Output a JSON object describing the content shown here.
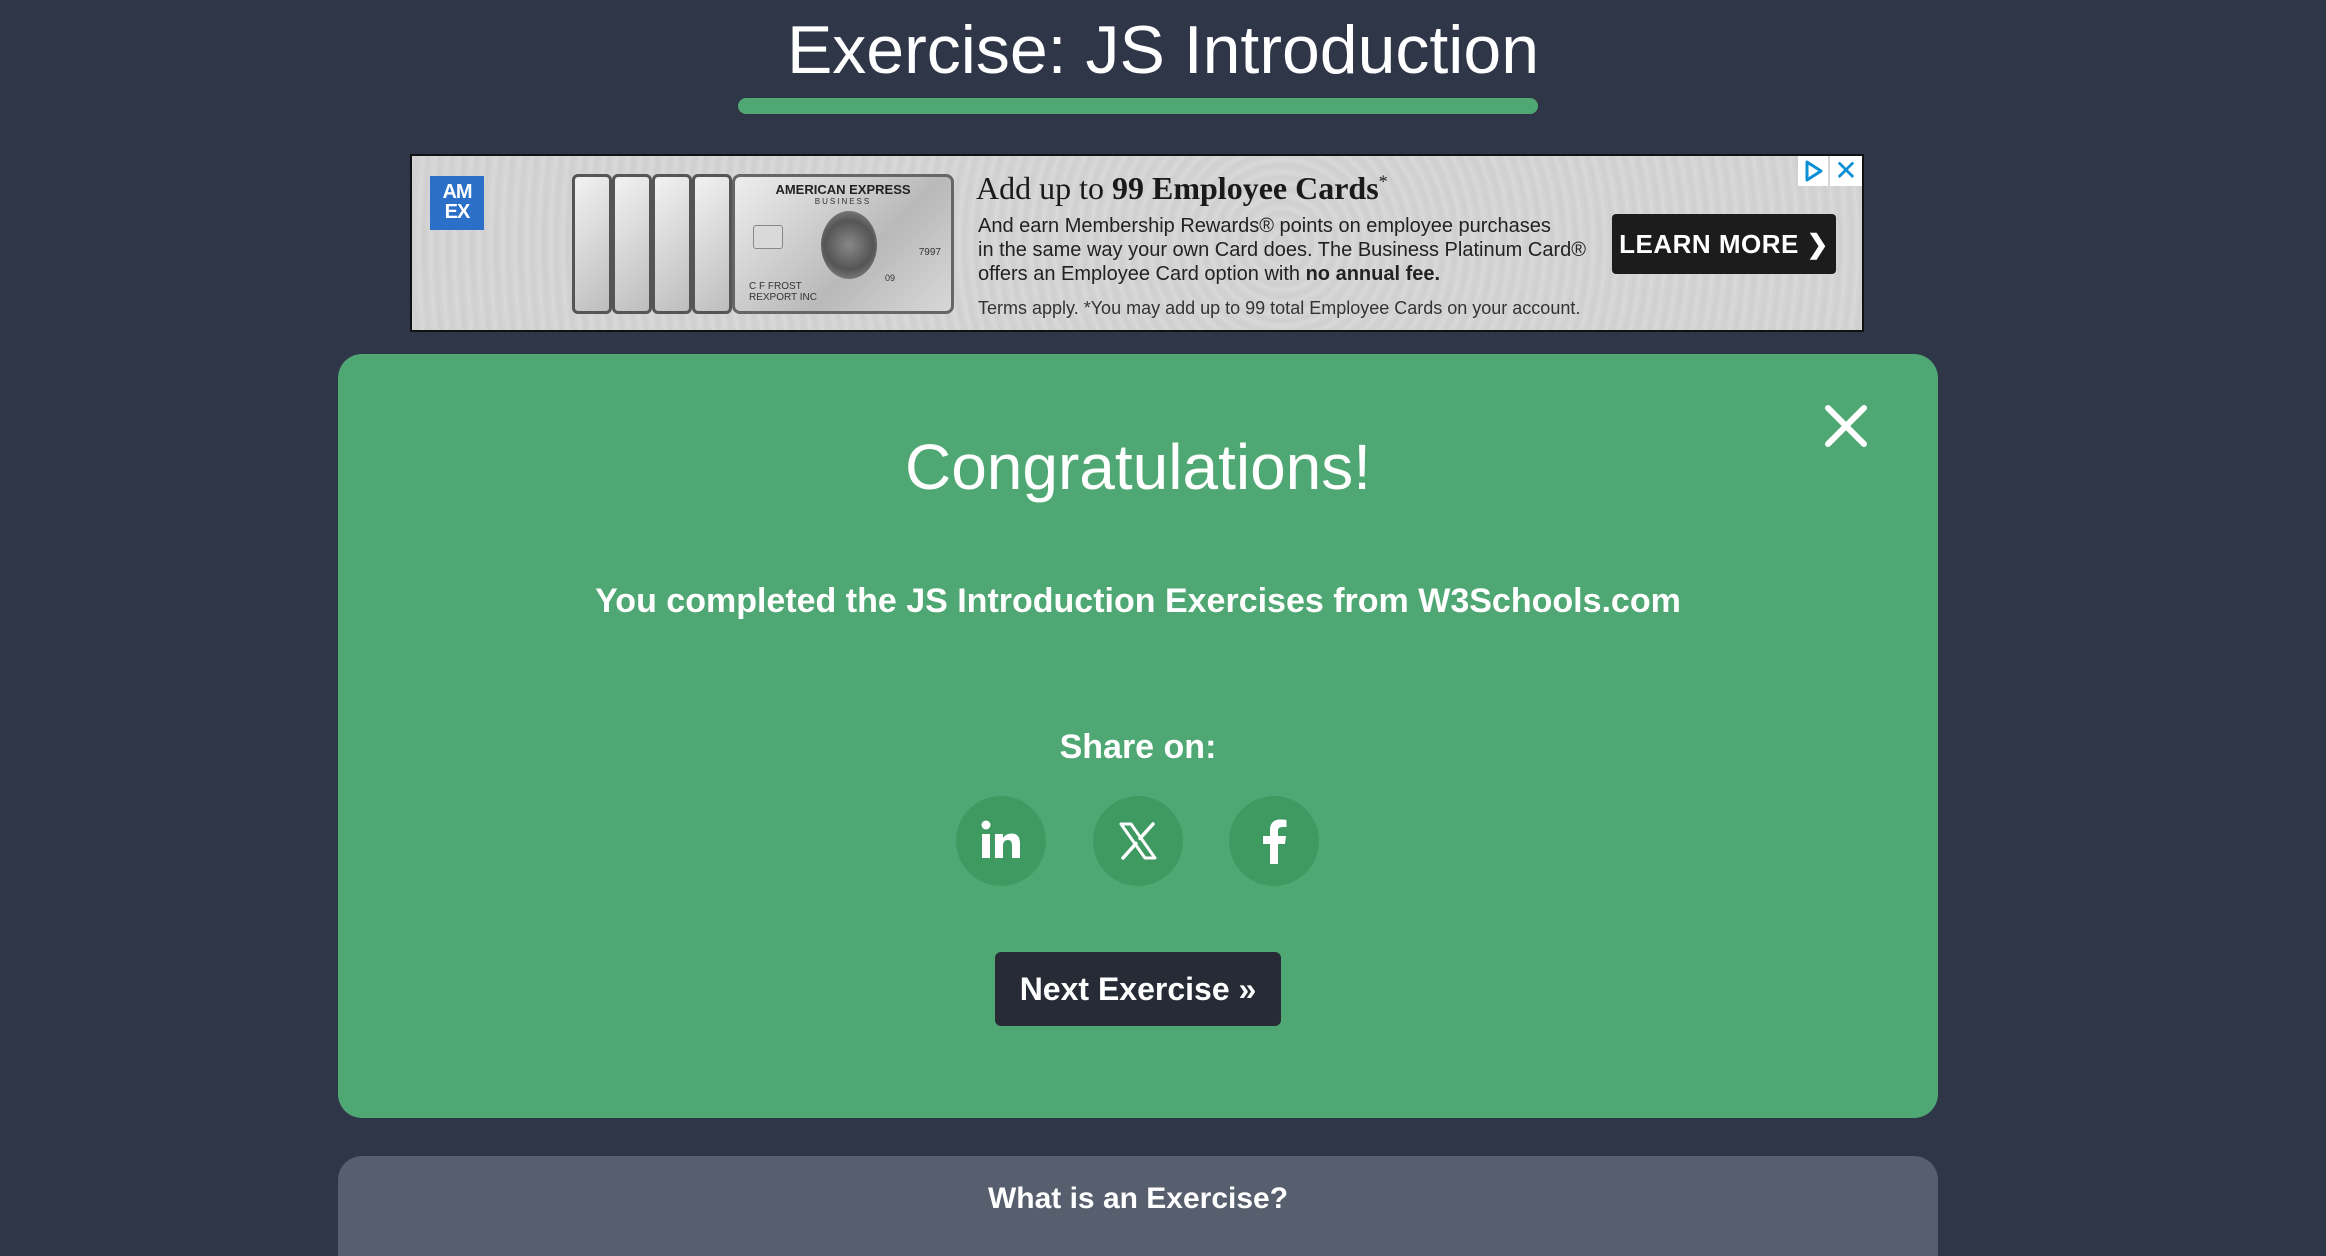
{
  "header": {
    "title": "Exercise: JS Introduction"
  },
  "ad": {
    "logo_text_line1": "AM",
    "logo_text_line2": "EX",
    "card_brand": "AMERICAN EXPRESS",
    "card_sub": "BUSINESS",
    "card_number": "7997",
    "card_holder_line1": "C F FROST",
    "card_holder_line2": "REXPORT INC",
    "card_expiry": "09",
    "headline_prefix": "Add up to ",
    "headline_bold": "99 Employee Cards",
    "headline_mark": "*",
    "body_line1": "And earn Membership Rewards® points on employee purchases",
    "body_line2": "in the same way your own Card does. The Business Platinum Card®",
    "body_line3_prefix": "offers an Employee Card option with ",
    "body_line3_bold": "no annual fee.",
    "terms": "Terms apply. *You may add up to 99 total Employee Cards on your account.",
    "cta_label": "LEARN MORE ❯",
    "close_glyph": "✕",
    "choices_icon": "adchoices-icon"
  },
  "congrats": {
    "title": "Congratulations!",
    "message": "You completed the JS Introduction Exercises from W3Schools.com",
    "share_label": "Share on:",
    "share_buttons": [
      {
        "name": "linkedin",
        "icon": "linkedin-icon"
      },
      {
        "name": "x",
        "icon": "x-icon"
      },
      {
        "name": "facebook",
        "icon": "facebook-icon"
      }
    ],
    "next_label": "Next Exercise »",
    "close_icon": "close-icon"
  },
  "info": {
    "title": "What is an Exercise?"
  },
  "colors": {
    "background": "#2f3647",
    "accent_green": "#4fa873",
    "share_circle": "#3f9a62",
    "dark_button": "#272b35",
    "info_panel": "#575e6e"
  }
}
